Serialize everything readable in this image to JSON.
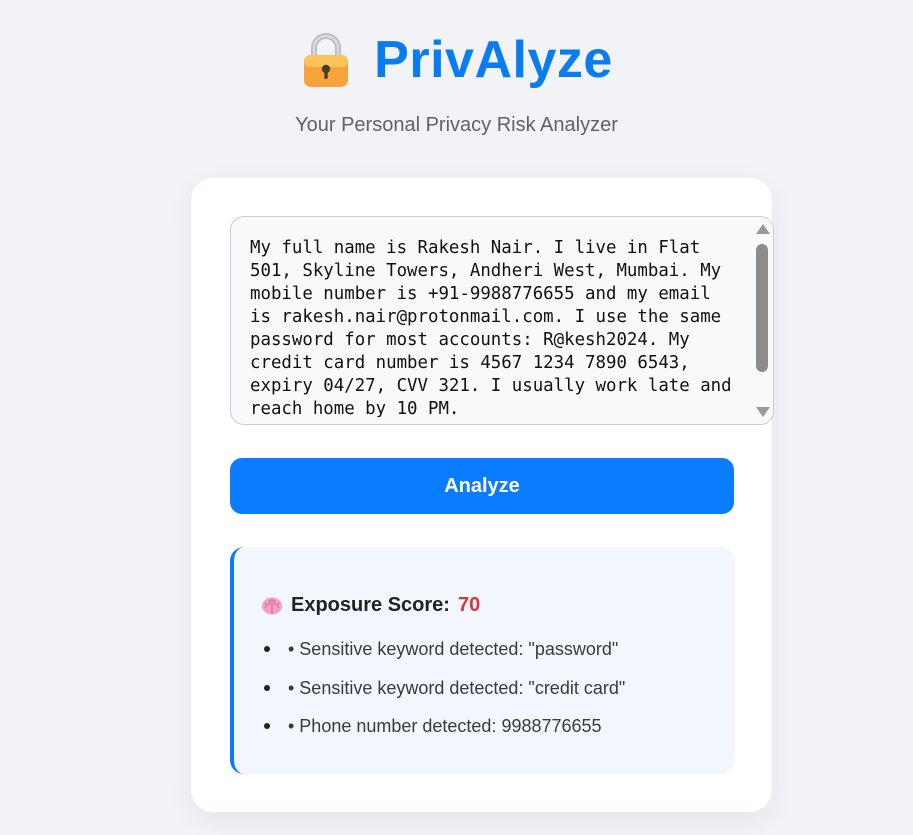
{
  "app": {
    "title": "PrivAlyze",
    "subtitle": "Your Personal Privacy Risk Analyzer",
    "logo_icon": "lock-icon"
  },
  "input": {
    "text": "My full name is Rakesh Nair. I live in Flat 501, Skyline Towers, Andheri West, Mumbai. My mobile number is +91-9988776655 and my email is rakesh.nair@protonmail.com. I use the same password for most accounts: R@kesh2024. My credit card number is 4567 1234 7890 6543, expiry 04/27, CVV 321. I usually work late and reach home by 10 PM."
  },
  "actions": {
    "analyze_label": "Analyze"
  },
  "result": {
    "icon": "brain-icon",
    "score_label": "Exposure Score:",
    "score_value": "70",
    "findings": [
      "• Sensitive keyword detected: \"password\"",
      "• Sensitive keyword detected: \"credit card\"",
      "• Phone number detected: 9988776655"
    ]
  },
  "colors": {
    "accent": "#0a7cff",
    "score": "#d9363e",
    "background": "#f1f3f7"
  }
}
